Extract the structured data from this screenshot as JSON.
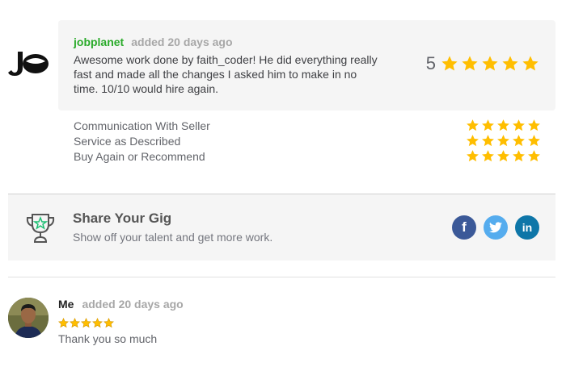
{
  "review": {
    "username": "jobplanet",
    "meta": "added 20 days ago",
    "text": "Awesome work done by faith_coder! He did everything really fast and made all the changes I asked him to make in no time. 10/10 would hire again.",
    "overall_rating": "5",
    "overall_stars": 5
  },
  "breakdown": [
    {
      "label": "Communication With Seller",
      "stars": 5
    },
    {
      "label": "Service as Described",
      "stars": 5
    },
    {
      "label": "Buy Again or Recommend",
      "stars": 5
    }
  ],
  "share": {
    "title": "Share Your Gig",
    "subtitle": "Show off your talent and get more work.",
    "facebook_glyph": "f",
    "twitter_glyph": "t",
    "linkedin_glyph": "in"
  },
  "reply": {
    "username": "Me",
    "meta": "added 20 days ago",
    "stars": 5,
    "text": "Thank you so much"
  },
  "colors": {
    "star": "#ffbe00",
    "username_green": "#2bab2b",
    "facebook": "#3b5998",
    "twitter": "#55acee",
    "linkedin": "#0e76a8"
  },
  "icons": {
    "buyer_logo": "jobplanet-logo",
    "share": "trophy-star-icon",
    "social": [
      "facebook-icon",
      "twitter-icon",
      "linkedin-icon"
    ]
  }
}
